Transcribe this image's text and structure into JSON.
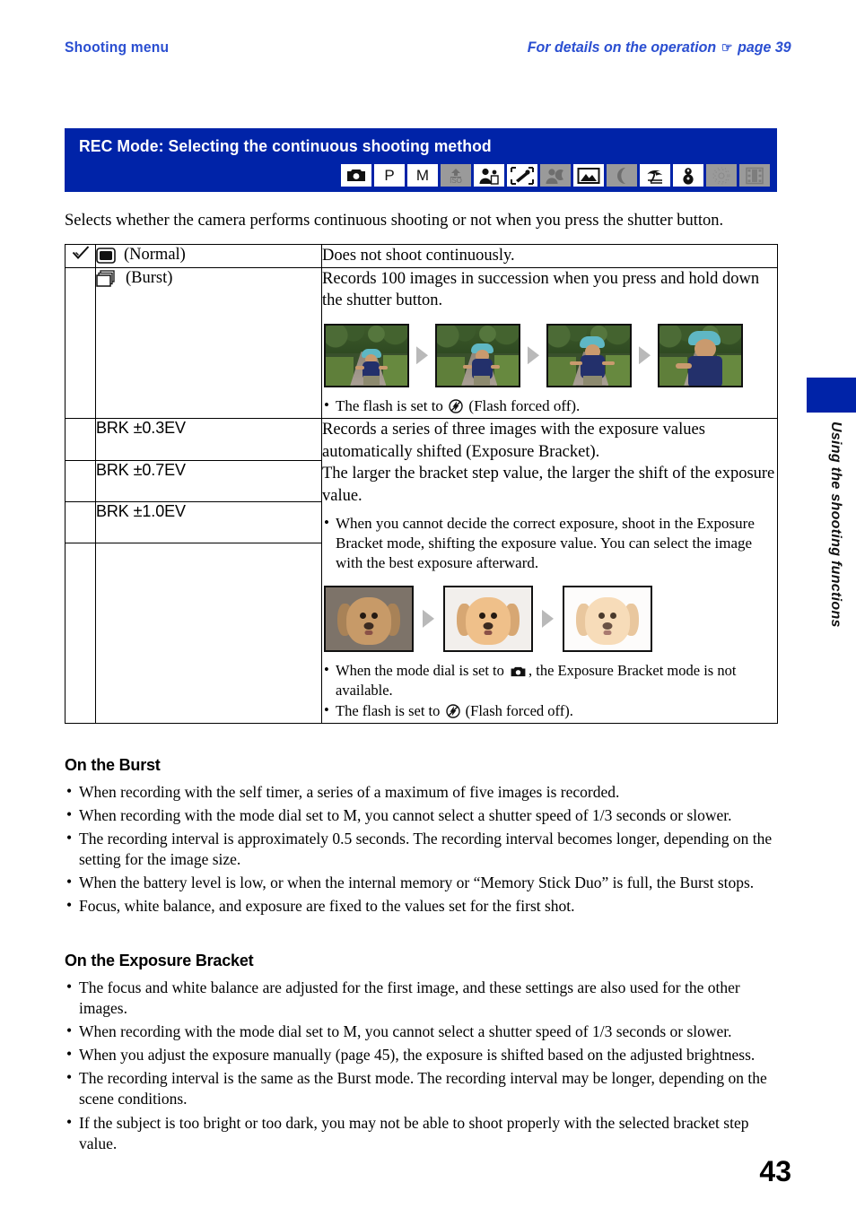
{
  "running_head": {
    "left": "Shooting menu",
    "right": "For details on the operation",
    "hand_icon": "pointing-hand-icon",
    "right_page_ref": "page 39"
  },
  "section_banner": {
    "title": "REC Mode: Selecting the continuous shooting method",
    "background_color": "#0023a8",
    "text_color": "#ffffff",
    "mode_icons": [
      {
        "name": "auto-camera-icon",
        "label": "",
        "enabled": true
      },
      {
        "name": "program-p-icon",
        "label": "P",
        "enabled": true
      },
      {
        "name": "manual-m-icon",
        "label": "M",
        "enabled": true
      },
      {
        "name": "high-sensitivity-iso-icon",
        "label": "ISO",
        "enabled": false
      },
      {
        "name": "soft-snap-icon",
        "label": "",
        "enabled": true
      },
      {
        "name": "advanced-sports-shooting-icon",
        "label": "",
        "enabled": true
      },
      {
        "name": "twilight-portrait-icon",
        "label": "",
        "enabled": false
      },
      {
        "name": "landscape-icon",
        "label": "",
        "enabled": true
      },
      {
        "name": "twilight-icon",
        "label": "",
        "enabled": false
      },
      {
        "name": "beach-icon",
        "label": "",
        "enabled": true
      },
      {
        "name": "snow-icon",
        "label": "",
        "enabled": true
      },
      {
        "name": "fireworks-icon",
        "label": "",
        "enabled": false
      },
      {
        "name": "movie-icon",
        "label": "",
        "enabled": false
      }
    ]
  },
  "intro": "Selects whether the camera performs continuous shooting or not when you press the shutter button.",
  "table": {
    "rows": [
      {
        "checked": true,
        "check_icon": "check-mark-icon",
        "icon": "single-frame-icon",
        "label": "(Normal)",
        "description": "Does not shoot continuously."
      },
      {
        "checked": false,
        "icon": "burst-frames-icon",
        "label": "(Burst)",
        "description": "Records 100 images in succession when you press and hold down the shutter button.",
        "photo_strip": {
          "name": "burst-sequence-photos",
          "caption_prefix": "The flash is set to",
          "caption_icon": "flash-off-icon",
          "caption_suffix": "(Flash forced off).",
          "frames": [
            "child-running-far",
            "child-running-mid",
            "child-running-near",
            "child-running-closeup"
          ]
        }
      }
    ],
    "bracket_labels": [
      "BRK ±0.3EV",
      "BRK ±0.7EV",
      "BRK ±1.0EV"
    ],
    "bracket_description_lines": [
      "Records a series of three images with the exposure values automatically shifted (Exposure Bracket).",
      "The larger the bracket step value, the larger the shift of the exposure value."
    ],
    "bracket_bullets_top": [
      "When you cannot decide the correct exposure, shoot in the Exposure Bracket mode, shifting the exposure value. You can select the image with the best exposure afterward."
    ],
    "bracket_photo_strip": {
      "name": "exposure-bracket-photos",
      "frames": [
        "dog-underexposed",
        "dog-normal-exposure",
        "dog-overexposed"
      ]
    },
    "bracket_bullets_bottom": [
      {
        "prefix": "When the mode dial is set to",
        "icon": "auto-camera-icon",
        "suffix": ", the Exposure Bracket mode is not available."
      },
      {
        "prefix": "The flash is set to",
        "icon": "flash-off-icon",
        "suffix": "(Flash forced off)."
      }
    ]
  },
  "on_the_burst": {
    "heading": "On the Burst",
    "items": [
      "When recording with the self timer, a series of a maximum of five images is recorded.",
      "When recording with the mode dial set to M, you cannot select a shutter speed of 1/3 seconds or slower.",
      "The recording interval is approximately 0.5 seconds. The recording interval becomes longer, depending on the setting for the image size.",
      "When the battery level is low, or when the internal memory or “Memory Stick Duo” is full, the Burst stops.",
      "Focus, white balance, and exposure are fixed to the values set for the first shot."
    ]
  },
  "on_the_exposure_bracket": {
    "heading": "On the Exposure Bracket",
    "items": [
      "The focus and white balance are adjusted for the first image, and these settings are also used for the other images.",
      "When recording with the mode dial set to M, you cannot select a shutter speed of 1/3 seconds or slower.",
      "When you adjust the exposure manually (page 45), the exposure is shifted based on the adjusted brightness.",
      "The recording interval is the same as the Burst mode. The recording interval may be longer, depending on the scene conditions.",
      "If the subject is too bright or too dark, you may not be able to shoot properly with the selected bracket step value."
    ]
  },
  "side_tab": {
    "label": "Using the shooting functions",
    "color": "#0023a8"
  },
  "page_number": "43"
}
